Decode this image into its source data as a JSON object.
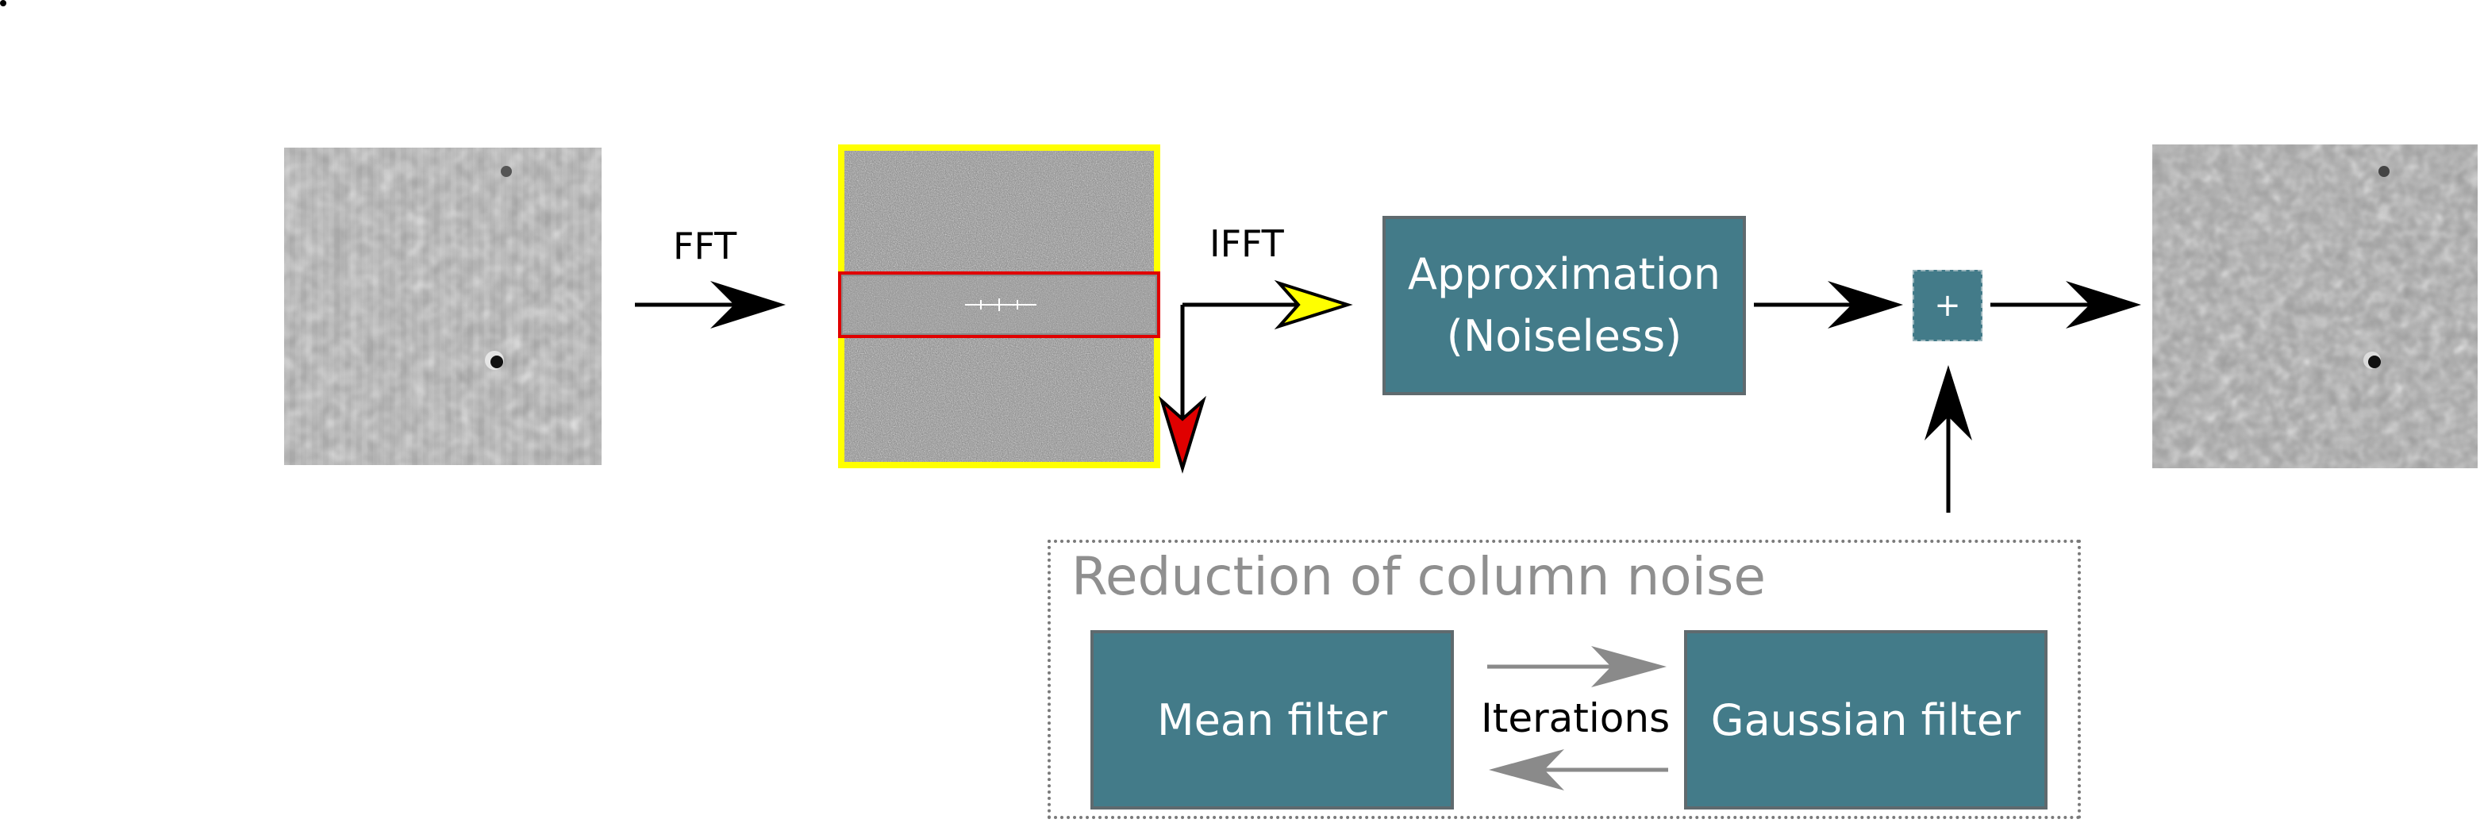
{
  "pipeline": {
    "fft_label": "FFT",
    "ifft_label": "IFFT",
    "approximation_line1": "Approximation",
    "approximation_line2": "(Noiseless)",
    "plus_symbol": "+"
  },
  "noise_reduction": {
    "title": "Reduction of column noise",
    "mean_filter": "Mean filter",
    "iterations": "Iterations",
    "gaussian_filter": "Gaussian filter"
  },
  "colors": {
    "box_fill": "#437b89",
    "box_border": "#5f6a6e",
    "frequency_keep_highlight": "#ffff00",
    "frequency_remove_highlight": "#e00000",
    "feedback_arrow": "#8a8a8a"
  }
}
